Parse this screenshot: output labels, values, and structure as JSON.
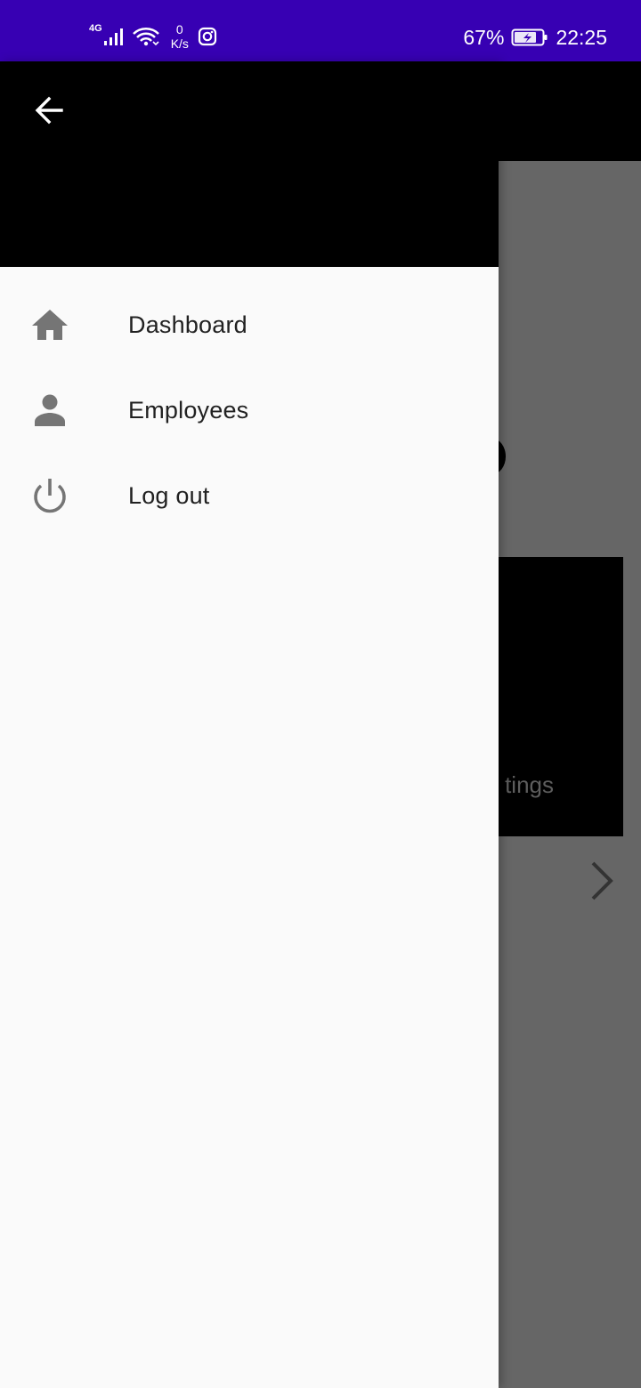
{
  "status_bar": {
    "network_type": "4G",
    "speed_value": "0",
    "speed_unit": "K/s",
    "battery_percent": "67%",
    "time": "22:25",
    "icons": [
      "signal-icon",
      "wifi-icon",
      "instagram-icon",
      "battery-charging-icon"
    ]
  },
  "drawer": {
    "back_icon": "arrow-back-icon",
    "items": [
      {
        "label": "Dashboard",
        "icon": "home-icon"
      },
      {
        "label": "Employees",
        "icon": "person-icon"
      },
      {
        "label": "Log out",
        "icon": "power-icon"
      }
    ]
  },
  "background": {
    "card_label": "tings",
    "chevron_icon": "chevron-right-icon"
  },
  "colors": {
    "status_bar": "#3700b3",
    "drawer_header": "#000000",
    "drawer_body": "#fafafa",
    "scrim": "#666666",
    "icon_gray": "#757575",
    "label_text": "#212121"
  }
}
